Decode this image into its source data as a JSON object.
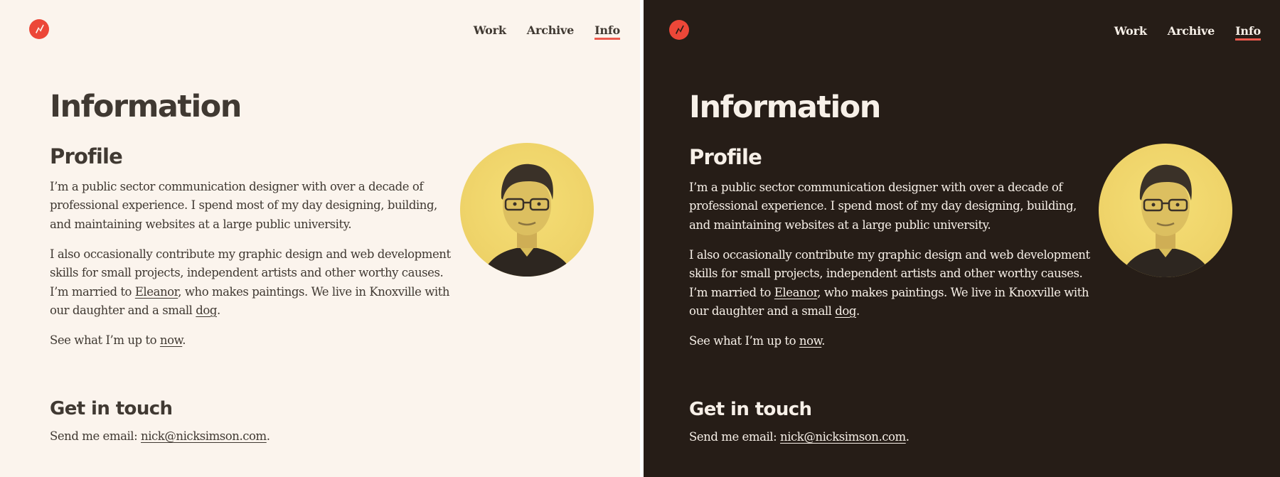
{
  "nav": {
    "work": "Work",
    "archive": "Archive",
    "info": "Info"
  },
  "page": {
    "title": "Information",
    "profile_heading": "Profile",
    "p1": "I’m a public sector communication designer with over a decade of professional experience. I spend most of my day designing, building, and maintaining websites at a large public university.",
    "p2_a": "I also occasionally contribute my graphic design and web development skills for small projects, independent artists and other worthy causes. I’m married to ",
    "p2_link_eleanor": "Eleanor",
    "p2_b": ", who makes paintings. We live in Knoxville with our daughter and a small ",
    "p2_link_dog": "dog",
    "p2_c": ".",
    "p3_a": "See what I’m up to ",
    "p3_link_now": "now",
    "p3_b": ".",
    "contact_heading": "Get in touch",
    "p4_a": "Send me email: ",
    "p4_email": "nick@nicksimson.com",
    "p4_b": "."
  },
  "icons": {
    "logo": "lightning-bolt-icon"
  },
  "colors": {
    "accent": "#ec4738",
    "light_bg": "#fbf4ed",
    "dark_bg": "#261d17",
    "avatar_tint": "#f1d76b"
  }
}
